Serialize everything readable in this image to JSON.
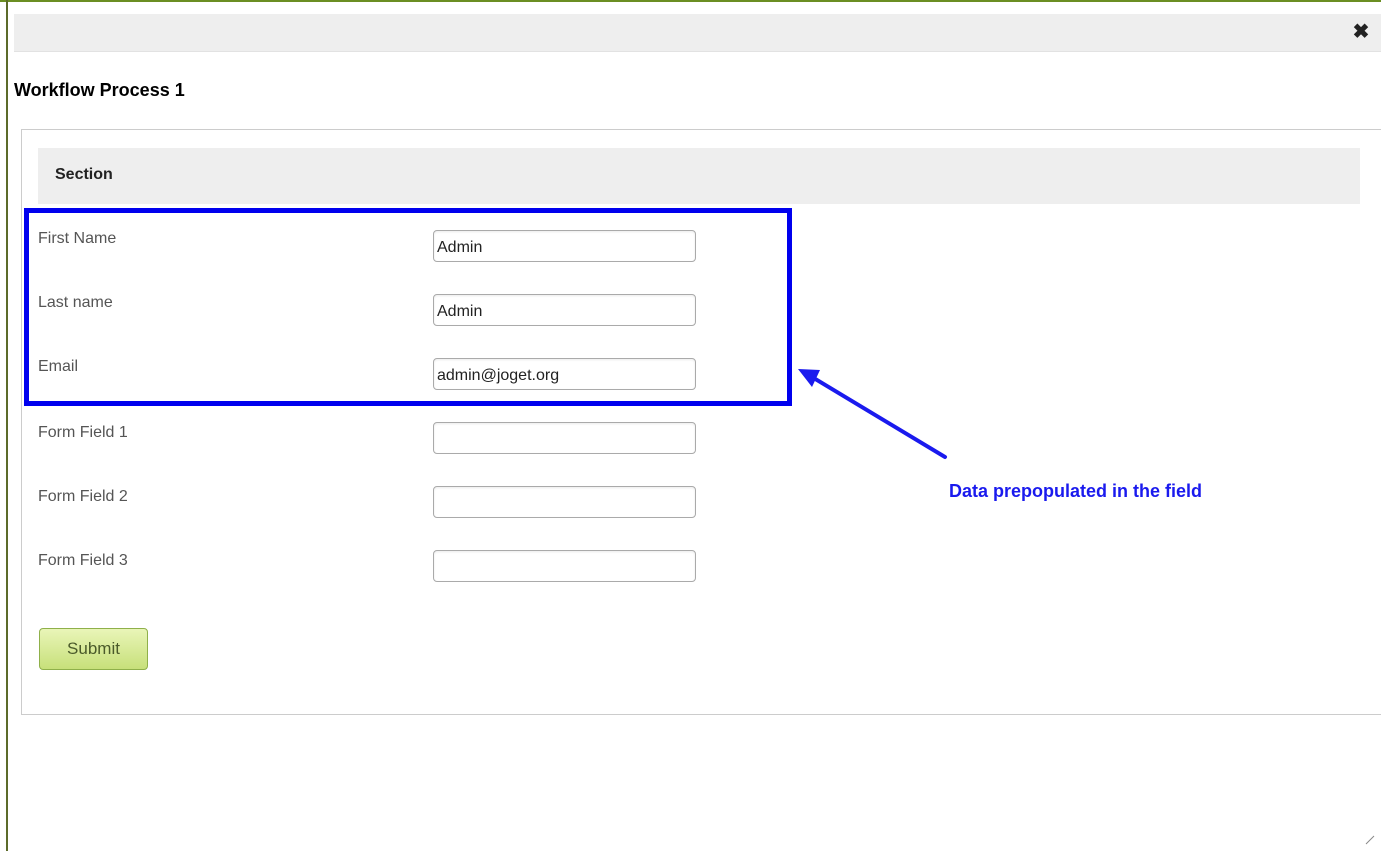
{
  "dialog": {
    "close_label": "✖",
    "title": "Workflow Process 1"
  },
  "form": {
    "section_title": "Section",
    "fields": [
      {
        "label": "First Name",
        "value": "Admin"
      },
      {
        "label": "Last name",
        "value": "Admin"
      },
      {
        "label": "Email",
        "value": "admin@joget.org"
      },
      {
        "label": "Form Field 1",
        "value": ""
      },
      {
        "label": "Form Field 2",
        "value": ""
      },
      {
        "label": "Form Field 3",
        "value": ""
      }
    ],
    "submit_label": "Submit"
  },
  "annotation": {
    "text": "Data prepopulated in the field",
    "color": "#1a1aee"
  },
  "colors": {
    "highlight": "#0000ee",
    "submit_bg": "#d6ea93",
    "accent_border": "#6b8e23"
  }
}
